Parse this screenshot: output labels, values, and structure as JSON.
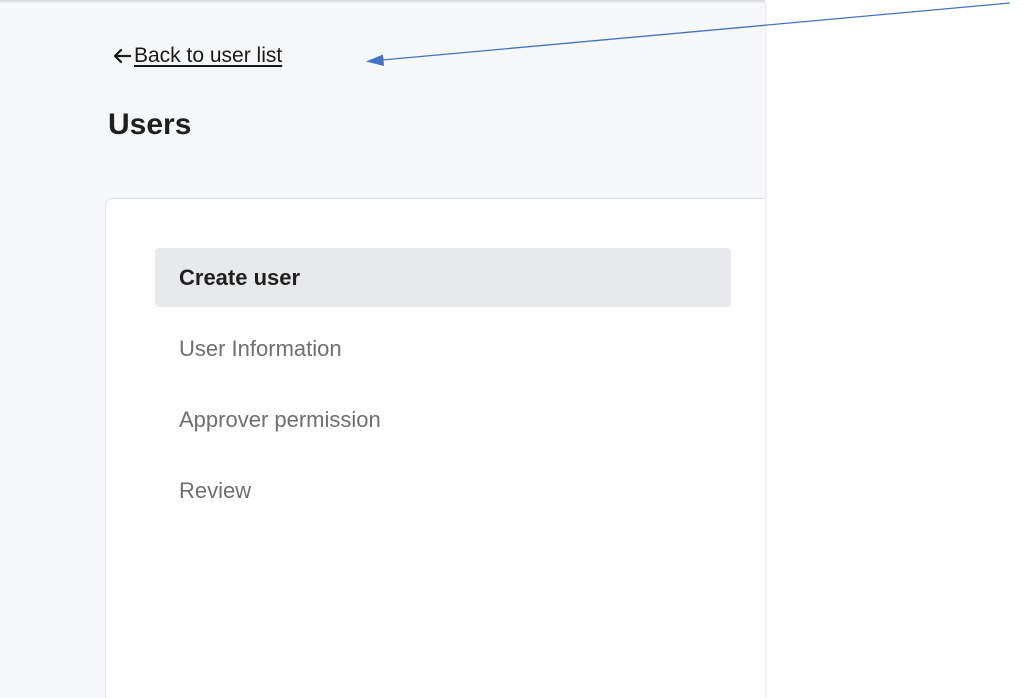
{
  "back_link": {
    "icon": "arrow-left-icon",
    "label": "Back to user list"
  },
  "page": {
    "title": "Users"
  },
  "wizard": {
    "steps": [
      {
        "label": "Create user",
        "active": true
      },
      {
        "label": "User Information",
        "active": false
      },
      {
        "label": "Approver permission",
        "active": false
      },
      {
        "label": "Review",
        "active": false
      }
    ]
  },
  "annotation": {
    "icon": "pointer-arrow",
    "color": "#4472c4"
  },
  "colors": {
    "panel_background": "#f6f7f8",
    "active_step_background": "#e8e9eb",
    "inactive_step_text": "#6f6f6f"
  }
}
